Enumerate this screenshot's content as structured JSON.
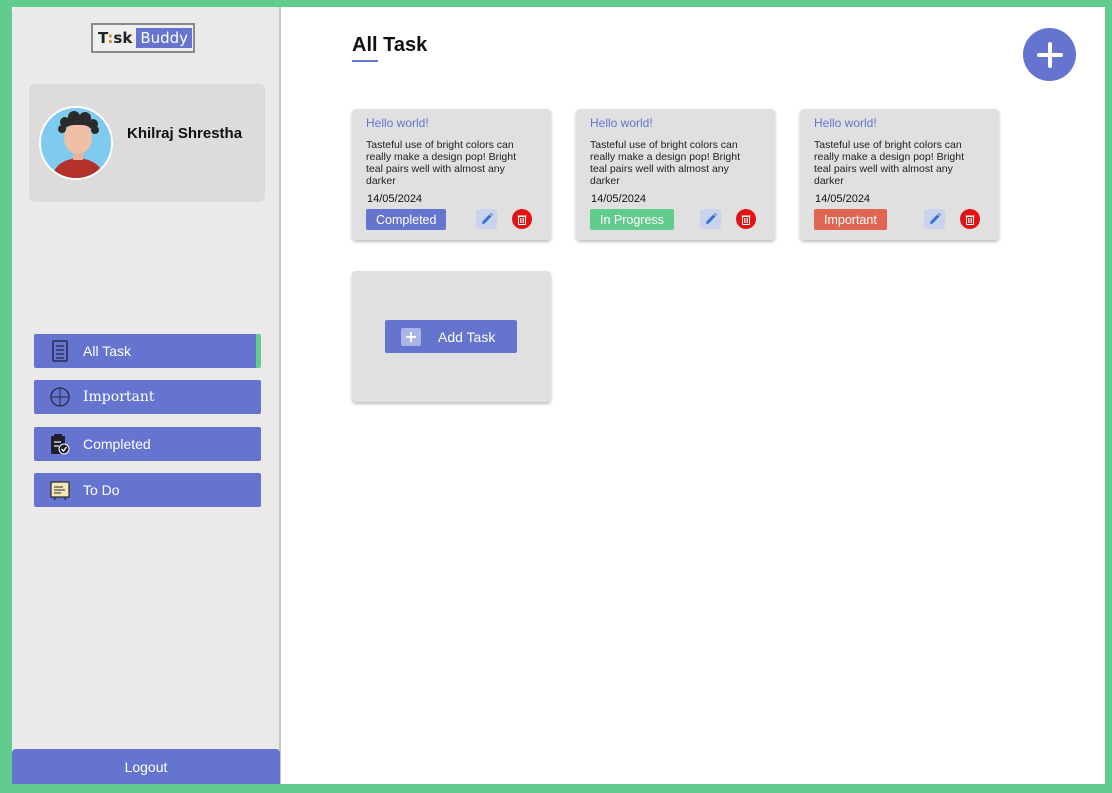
{
  "app": {
    "logo_part1": "T",
    "logo_dot": ":",
    "logo_part2": "sk",
    "logo_part3": "Buddy"
  },
  "profile": {
    "name": "Khilraj Shrestha"
  },
  "nav": {
    "items": [
      {
        "label": "All Task",
        "icon": "list-icon",
        "active": true
      },
      {
        "label": "Important",
        "icon": "target-icon",
        "active": false
      },
      {
        "label": "Completed",
        "icon": "clipboard-check-icon",
        "active": false
      },
      {
        "label": "To Do",
        "icon": "note-icon",
        "active": false
      }
    ]
  },
  "logout_label": "Logout",
  "main": {
    "title": "All Task",
    "add_task_label": "Add Task"
  },
  "cards": [
    {
      "title": "Hello world!",
      "description": "Tasteful use of bright colors can really make a design pop! Bright teal pairs well with almost any darker",
      "date": "14/05/2024",
      "status": "Completed",
      "status_color": "#6474cf"
    },
    {
      "title": "Hello world!",
      "description": "Tasteful use of bright colors can really make a design pop! Bright teal pairs well with almost any darker",
      "date": "14/05/2024",
      "status": "In Progress",
      "status_color": "#62cb8e"
    },
    {
      "title": "Hello world!",
      "description": "Tasteful use of bright colors can really make a design pop! Bright teal pairs well with almost any darker",
      "date": "14/05/2024",
      "status": "Important",
      "status_color": "#e06553"
    }
  ],
  "colors": {
    "accent": "#6474cf",
    "background": "#62cb8e",
    "sidebar": "#ebe9ea",
    "danger": "#e01414"
  }
}
